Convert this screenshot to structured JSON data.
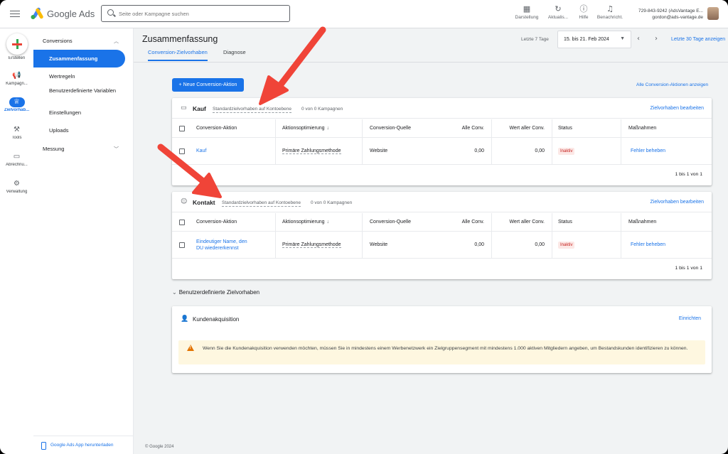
{
  "app": {
    "brand": "Google Ads",
    "search_placeholder": "Seite oder Kampagne suchen"
  },
  "toolbar": [
    {
      "icon": "appearance-icon",
      "label": "Darstellung"
    },
    {
      "icon": "refresh-icon",
      "label": "Aktualis..."
    },
    {
      "icon": "help-icon",
      "label": "Hilfe"
    },
    {
      "icon": "bell-icon",
      "label": "Benachricht."
    }
  ],
  "account": {
    "id_line": "729-843-9242 (AdsVantage E...",
    "email": "gordon@ads-vantage.de"
  },
  "rail": {
    "create_label": "Erstellen",
    "items": [
      {
        "icon": "megaphone-icon",
        "label": "Kampagn..."
      },
      {
        "icon": "trophy-icon",
        "label": "Zielvorhab...",
        "active": true
      },
      {
        "icon": "tools-icon",
        "label": "Tools"
      },
      {
        "icon": "card-icon",
        "label": "Abrechnu..."
      },
      {
        "icon": "gear-icon",
        "label": "Verwaltung"
      }
    ]
  },
  "subnav": {
    "section1": "Conversions",
    "items": [
      "Zusammenfassung",
      "Wertregeln",
      "Benutzerdefinierte Variablen",
      "Einstellungen",
      "Uploads"
    ],
    "section2": "Messung",
    "app_download": "Google Ads App herunterladen"
  },
  "page": {
    "title": "Zusammenfassung",
    "tabs": [
      "Conversion-Zielvorhaben",
      "Diagnose"
    ],
    "range_label": "Letzte 7 Tage",
    "date_range": "15. bis 21. Feb 2024",
    "last30": "Letzte 30 Tage anzeigen",
    "new_button": "+ Neue Conversion-Aktion",
    "all_actions_link": "Alle Conversion-Aktionen anzeigen",
    "custom_section": "Benutzerdefinierte Zielvorhaben",
    "footer": "© Google 2024"
  },
  "columns": [
    "Conversion-Aktion",
    "Aktionsoptimierung",
    "Conversion-Quelle",
    "Alle Conv.",
    "Wert aller Conv.",
    "Status",
    "Maßnahmen"
  ],
  "cards": {
    "kauf": {
      "title": "Kauf",
      "standard": "Standardzielvorhaben auf Kontoebene",
      "campaigns": "0 von 0 Kampagnen",
      "edit": "Zielvorhaben bearbeiten",
      "row": {
        "action": "Kauf",
        "optimization": "Primäre Zahlungsmethode",
        "source": "Website",
        "all_conv": "0,00",
        "value": "0,00",
        "status": "Inaktiv",
        "measure": "Fehler beheben"
      },
      "pager": "1 bis 1 von 1"
    },
    "kontakt": {
      "title": "Kontakt",
      "standard": "Standardzielvorhaben auf Kontoebene",
      "campaigns": "0 von 0 Kampagnen",
      "edit": "Zielvorhaben bearbeiten",
      "row": {
        "action_line1": "Eindeutiger Name, den",
        "action_line2": "DU wiedererkennst",
        "optimization": "Primäre Zahlungsmethode",
        "source": "Website",
        "all_conv": "0,00",
        "value": "0,00",
        "status": "Inaktiv",
        "measure": "Fehler beheben"
      },
      "pager": "1 bis 1 von 1"
    },
    "kunden": {
      "title": "Kundenakquisition",
      "setup": "Einrichten",
      "notice": "Wenn Sie die Kundenakquisition verwenden möchten, müssen Sie in mindestens einem Werbenetzwerk ein Zielgruppensegment mit mindestens 1.000 aktiven Mitgliedern angeben, um Bestandskunden identifizieren zu können."
    }
  },
  "colors": {
    "accent": "#1a73e8",
    "arrow": "#f04438",
    "badge_bg": "#fce8e6",
    "notice_bg": "#fef7e0"
  }
}
